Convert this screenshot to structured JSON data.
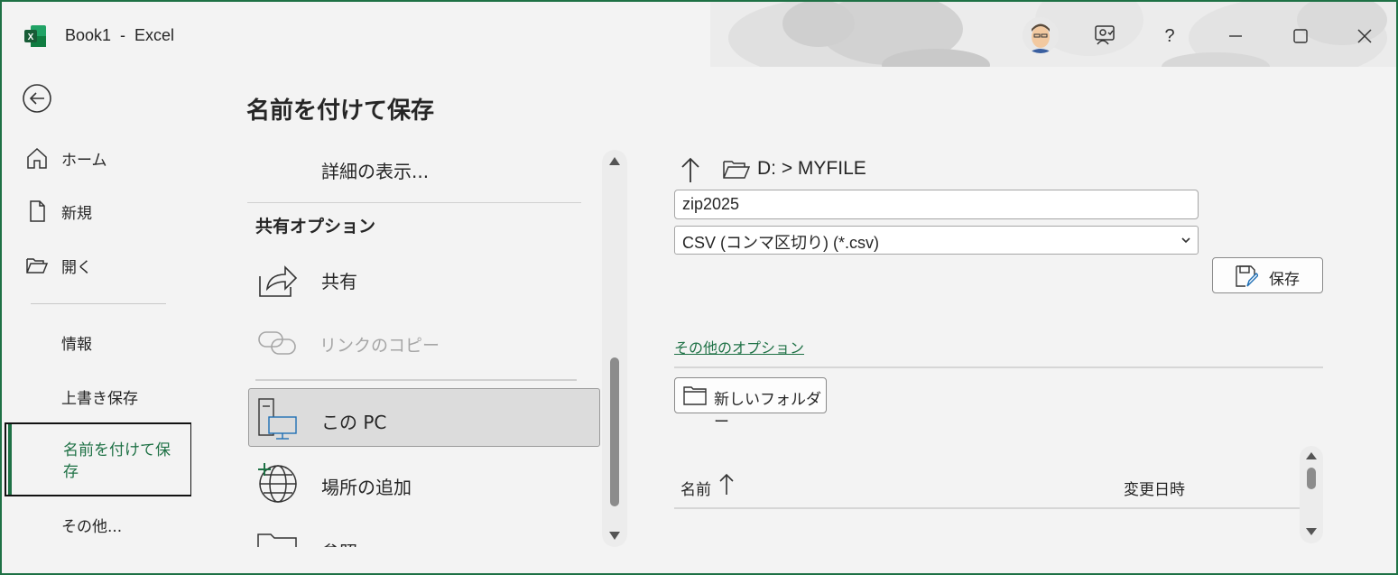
{
  "window": {
    "title": "Book1  -  Excel",
    "accent_color": "#1e7145"
  },
  "titlebar": {
    "app_icon": "excel-icon",
    "buttons": [
      "avatar",
      "coauthor-icon",
      "help-icon",
      "minimize-icon",
      "maximize-icon",
      "close-icon"
    ],
    "help_label": "?"
  },
  "leftnav": {
    "items": [
      {
        "label": "ホーム",
        "icon": "home-icon"
      },
      {
        "label": "新規",
        "icon": "new-file-icon"
      },
      {
        "label": "開く",
        "icon": "folder-open-icon"
      },
      {
        "label": "情報"
      },
      {
        "label": "上書き保存"
      },
      {
        "label": "名前を付けて保存",
        "active": true
      },
      {
        "label": "その他..."
      }
    ]
  },
  "main": {
    "title": "名前を付けて保存",
    "locations": {
      "details": "詳細の表示...",
      "share_heading": "共有オプション",
      "share": "共有",
      "copy_link": "リンクのコピー",
      "this_pc": "この PC",
      "add_place": "場所の追加",
      "browse": "参照"
    },
    "right": {
      "path": "D: > MYFILE",
      "filename": "zip2025",
      "filetype": "CSV (コンマ区切り) (*.csv)",
      "save_label": "保存",
      "more_options": "その他のオプション",
      "new_folder": "新しいフォルダー",
      "col_name": "名前",
      "col_date": "変更日時"
    }
  }
}
